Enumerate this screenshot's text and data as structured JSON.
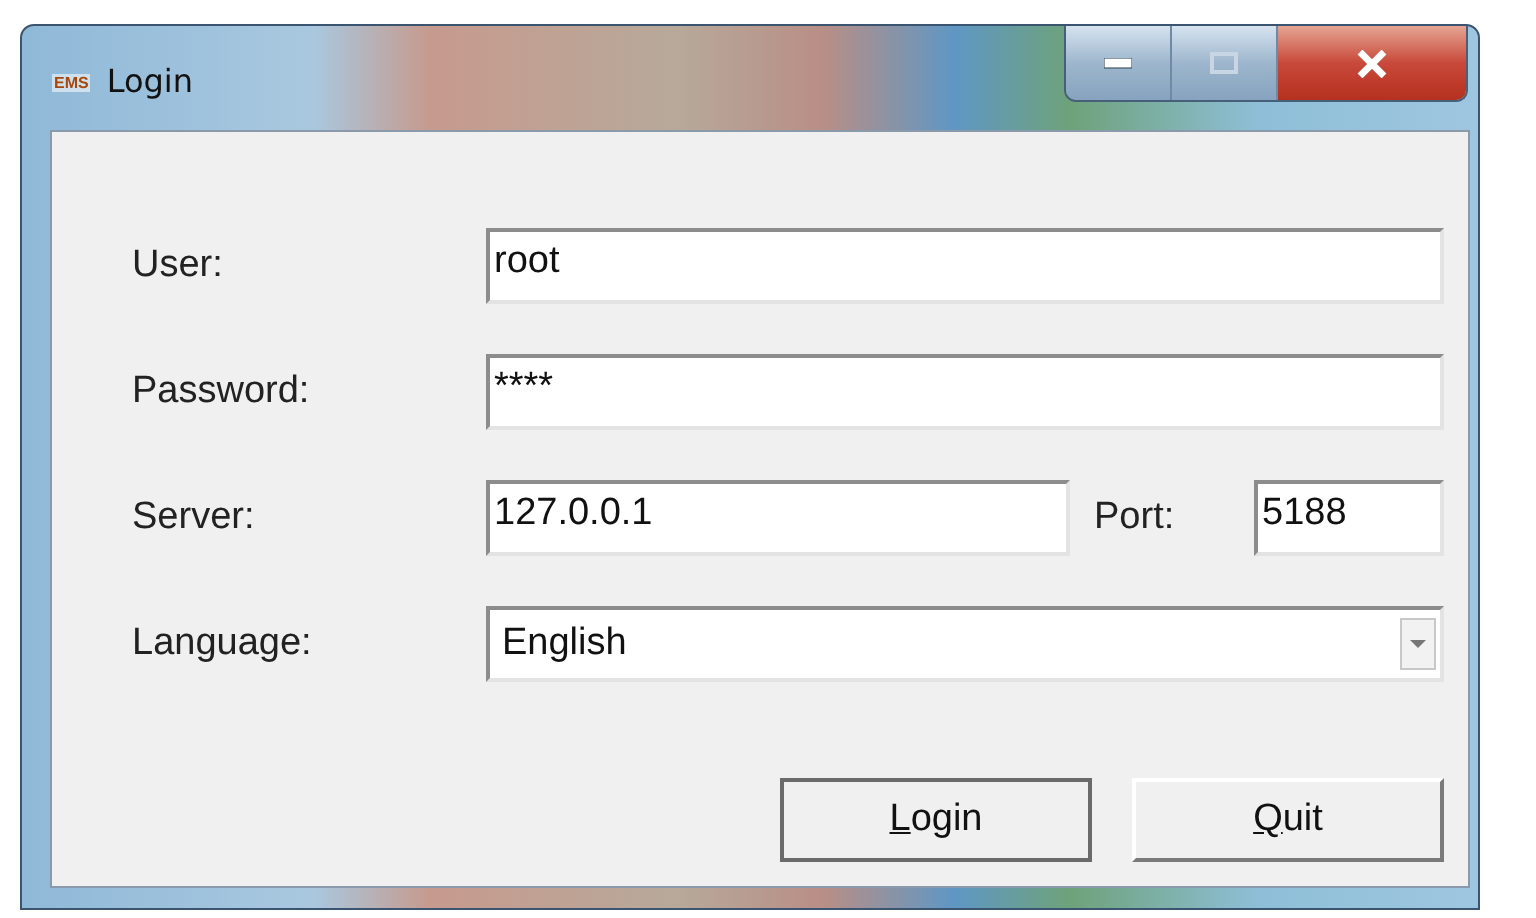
{
  "window": {
    "app_logo": "EMS",
    "title": "Login",
    "controls": {
      "maximize_disabled": true
    }
  },
  "form": {
    "fields": [
      {
        "kind": "text",
        "label": "User:",
        "value": "root"
      },
      {
        "kind": "text",
        "label": "Password:",
        "value": "****"
      },
      {
        "kind": "server",
        "label": "Server:",
        "value": "127.0.0.1",
        "port_label": "Port:",
        "port_value": "5188"
      },
      {
        "kind": "dropdown",
        "label": "Language:",
        "value": "English"
      }
    ]
  },
  "buttons": [
    {
      "label": "Login",
      "underline_first": true,
      "default": true
    },
    {
      "label": "Quit",
      "underline_first": true,
      "default": false
    }
  ]
}
